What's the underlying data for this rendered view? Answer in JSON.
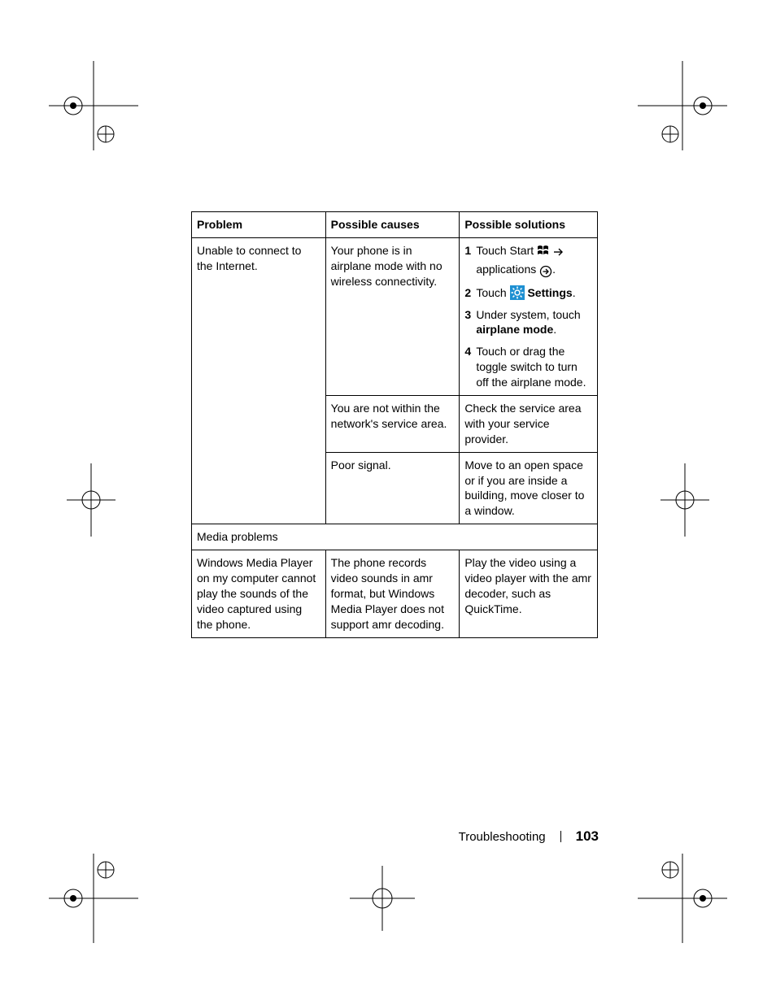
{
  "headers": {
    "problem": "Problem",
    "causes": "Possible causes",
    "solutions": "Possible solutions"
  },
  "rows": {
    "r1": {
      "problem": "Unable to connect to the Internet.",
      "cause": "Your phone is in airplane mode with no wireless connectivity.",
      "sol": {
        "s1a": "Touch Start",
        "s1b": "applications",
        "s2a": "Touch",
        "s2b": "Settings",
        "s3a": "Under system, touch",
        "s3b": "airplane mode",
        "s4": "Touch or drag the toggle switch to turn off the airplane mode."
      }
    },
    "r2": {
      "cause": "You are not within the network's service area.",
      "sol": "Check the service area with your service provider."
    },
    "r3": {
      "cause": "Poor signal.",
      "sol": "Move to an open space or if you are inside a building, move closer to a window."
    },
    "section_media": "Media problems",
    "r4": {
      "problem": "Windows Media Player on my computer cannot play the sounds of the video captured using the phone.",
      "cause": "The phone records video sounds in amr format, but Windows Media Player does not support amr decoding.",
      "sol": "Play the video using a video player with the amr decoder, such as QuickTime."
    }
  },
  "footer": {
    "section": "Troubleshooting",
    "page": "103"
  },
  "icons": {
    "start": "windows-logo-icon",
    "arrow_right": "arrow-right-icon",
    "circle_arrow": "circle-arrow-right-icon",
    "settings": "gear-icon"
  }
}
